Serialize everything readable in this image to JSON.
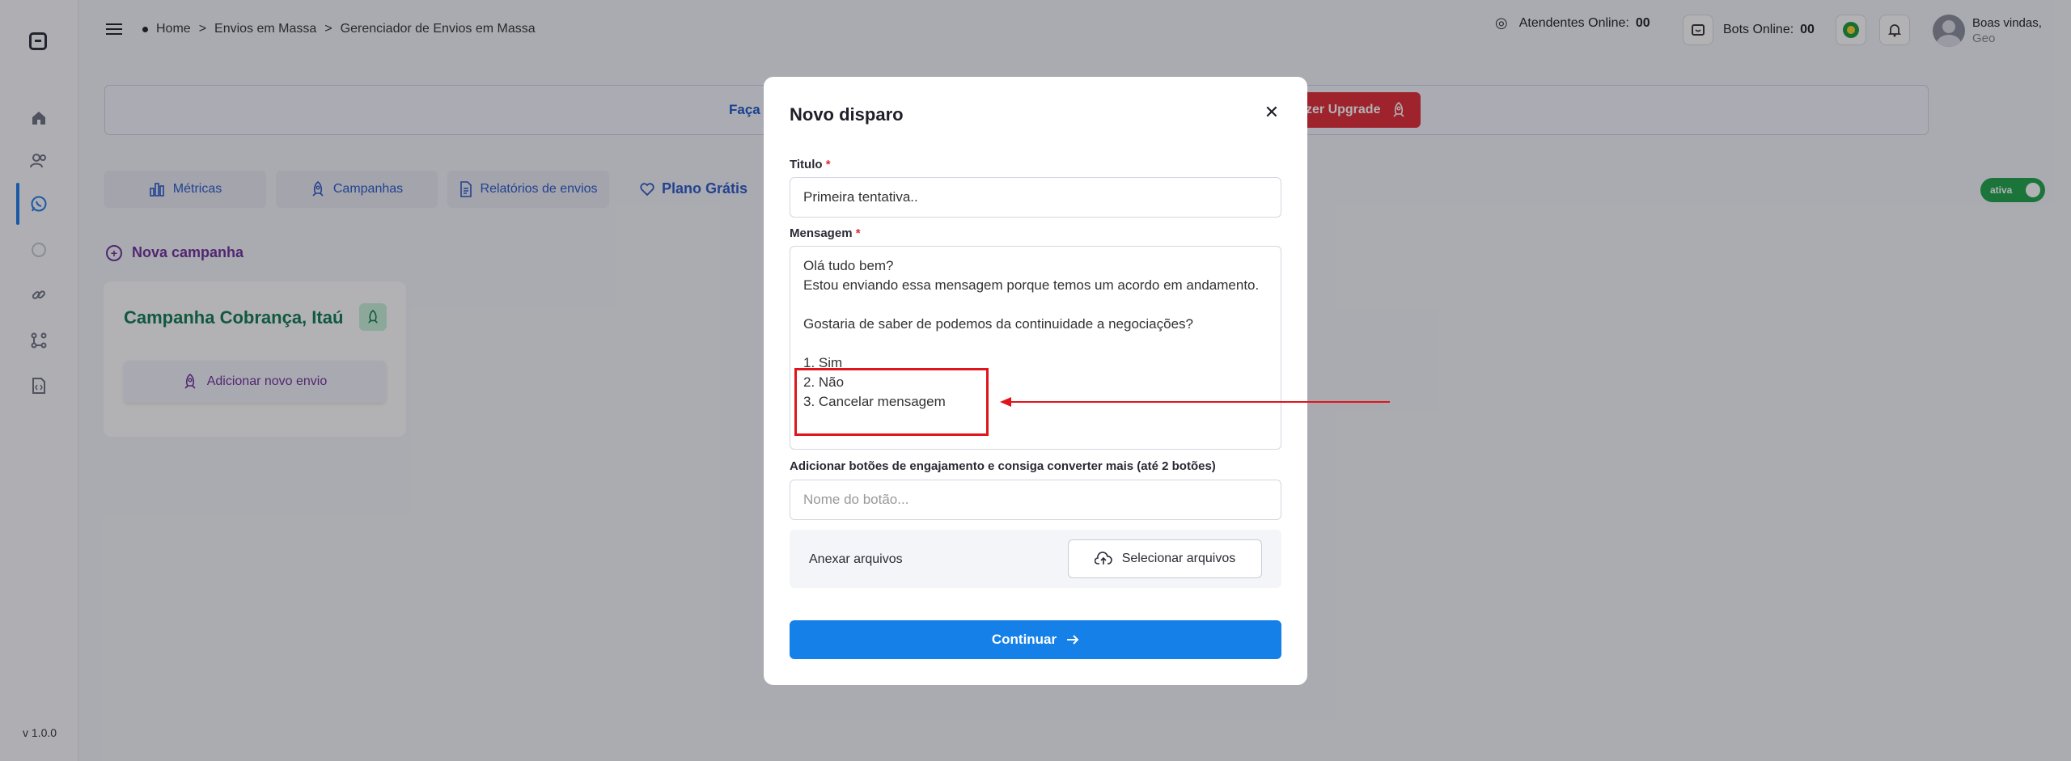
{
  "sidebar": {
    "version": "v 1.0.0",
    "icons": [
      "logo-icon",
      "home-icon",
      "users-icon",
      "whatsapp-icon",
      "chat-icon",
      "link-icon",
      "flow-icon",
      "code-icon"
    ]
  },
  "header": {
    "breadcrumb": [
      "Home",
      ">",
      "Envios em Massa",
      ">",
      "Gerenciador de Envios em Massa"
    ],
    "attendants_online_label": "Atendentes Online:",
    "attendants_online_value": "00",
    "bots_online_label": "Bots Online:",
    "bots_online_value": "00",
    "welcome": "Boas vindas,",
    "user_name": "Geo"
  },
  "banner": {
    "text": "Faça",
    "upgrade_label": "zer Upgrade"
  },
  "tabs": [
    {
      "label": "Métricas",
      "icon": "chart-icon"
    },
    {
      "label": "Campanhas",
      "icon": "rocket-icon"
    },
    {
      "label": "Relatórios de envios",
      "icon": "report-icon"
    }
  ],
  "plan_label": "Plano Grátis",
  "status_toggle": "ativa",
  "new_campaign": "Nova campanha",
  "campaign": {
    "title": "Campanha Cobrança, Itaú",
    "add_label": "Adicionar novo envio"
  },
  "modal": {
    "title": "Novo disparo",
    "title_label": "Titulo",
    "title_value": "Primeira tentativa..",
    "message_label": "Mensagem",
    "message_value": "Olá tudo bem?\nEstou enviando essa mensagem porque temos um acordo em andamento.\n\nGostaria de saber de podemos da continuidade a negociações?\n\n1. Sim\n2. Não\n3. Cancelar mensagem",
    "buttons_label": "Adicionar botões de engajamento e consiga converter mais (até 2 botões)",
    "button_placeholder": "Nome do botão...",
    "attach_label": "Anexar arquivos",
    "select_files": "Selecionar arquivos",
    "continue": "Continuar",
    "required_mark": "*"
  },
  "colors": {
    "primary": "#1480e8",
    "danger": "#e22a33",
    "campaign_green": "#0f7a4f",
    "purple": "#6f2f9a",
    "annotation_red": "#e0141b"
  }
}
